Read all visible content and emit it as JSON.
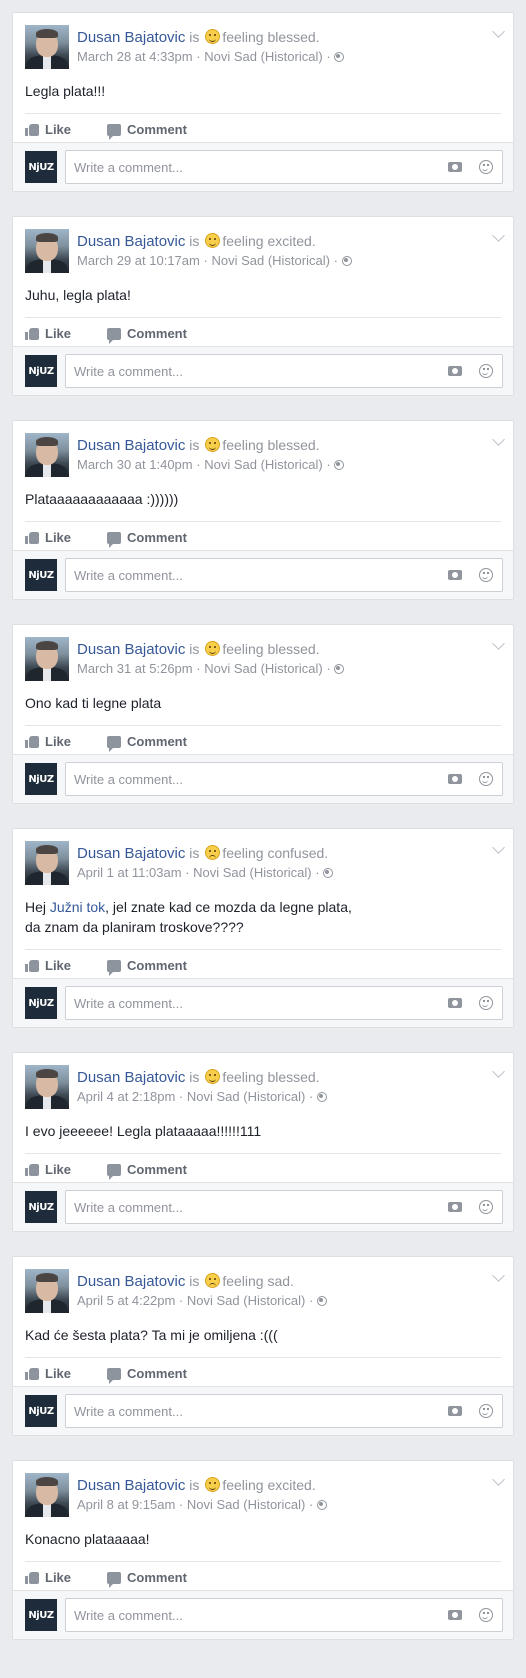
{
  "posts": [
    {
      "author": "Dusan Bajatovic",
      "is": "is",
      "feeling_icon": "blessed-emoji-icon",
      "feeling": "feeling blessed.",
      "date": "March 28 at 4:33pm",
      "location": "Novi Sad (Historical)",
      "sep": "·",
      "text_before": "Legla plata!!!",
      "mention": "",
      "text_after": "",
      "like_label": "Like",
      "comment_label": "Comment",
      "page_avatar": "NjUZ",
      "comment_placeholder": "Write a comment..."
    },
    {
      "author": "Dusan Bajatovic",
      "is": "is",
      "feeling_icon": "excited-emoji-icon",
      "feeling": "feeling excited.",
      "date": "March 29 at 10:17am",
      "location": "Novi Sad (Historical)",
      "sep": "·",
      "text_before": "Juhu, legla plata!",
      "mention": "",
      "text_after": "",
      "like_label": "Like",
      "comment_label": "Comment",
      "page_avatar": "NjUZ",
      "comment_placeholder": "Write a comment..."
    },
    {
      "author": "Dusan Bajatovic",
      "is": "is",
      "feeling_icon": "blessed-emoji-icon",
      "feeling": "feeling blessed.",
      "date": "March 30 at 1:40pm",
      "location": "Novi Sad (Historical)",
      "sep": "·",
      "text_before": "Platаaaaaaaaaaaa :))))))",
      "mention": "",
      "text_after": "",
      "like_label": "Like",
      "comment_label": "Comment",
      "page_avatar": "NjUZ",
      "comment_placeholder": "Write a comment..."
    },
    {
      "author": "Dusan Bajatovic",
      "is": "is",
      "feeling_icon": "blessed-emoji-icon",
      "feeling": "feeling blessed.",
      "date": "March 31 at 5:26pm",
      "location": "Novi Sad (Historical)",
      "sep": "·",
      "text_before": "Ono kad ti legne plata",
      "mention": "",
      "text_after": "",
      "like_label": "Like",
      "comment_label": "Comment",
      "page_avatar": "NjUZ",
      "comment_placeholder": "Write a comment..."
    },
    {
      "author": "Dusan Bajatovic",
      "is": "is",
      "feeling_icon": "confused-emoji-icon",
      "feeling": "feeling confused.",
      "date": "April 1 at 11:03am",
      "location": "Novi Sad (Historical)",
      "sep": "·",
      "text_before": "Hej ",
      "mention": "Južni tok",
      "text_after": ", jel znate kad ce mozda da legne plata, da znam da planiram troskove????",
      "like_label": "Like",
      "comment_label": "Comment",
      "page_avatar": "NjUZ",
      "comment_placeholder": "Write a comment..."
    },
    {
      "author": "Dusan Bajatovic",
      "is": "is",
      "feeling_icon": "blessed-emoji-icon",
      "feeling": "feeling blessed.",
      "date": "April 4 at 2:18pm",
      "location": "Novi Sad (Historical)",
      "sep": "·",
      "text_before": "I evo jeeeeee! Legla plataaaaa!!!!!!111",
      "mention": "",
      "text_after": "",
      "like_label": "Like",
      "comment_label": "Comment",
      "page_avatar": "NjUZ",
      "comment_placeholder": "Write a comment..."
    },
    {
      "author": "Dusan Bajatovic",
      "is": "is",
      "feeling_icon": "sad-emoji-icon",
      "feeling": "feeling sad.",
      "date": "April 5 at 4:22pm",
      "location": "Novi Sad (Historical)",
      "sep": "·",
      "text_before": "Kad će šesta plata? Ta mi je omiljena :(((",
      "mention": "",
      "text_after": "",
      "like_label": "Like",
      "comment_label": "Comment",
      "page_avatar": "NjUZ",
      "comment_placeholder": "Write a comment..."
    },
    {
      "author": "Dusan Bajatovic",
      "is": "is",
      "feeling_icon": "excited-emoji-icon",
      "feeling": "feeling excited.",
      "date": "April 8 at 9:15am",
      "location": "Novi Sad (Historical)",
      "sep": "·",
      "text_before": "Konacno plataaaaa!",
      "mention": "",
      "text_after": "",
      "like_label": "Like",
      "comment_label": "Comment",
      "page_avatar": "NjUZ",
      "comment_placeholder": "Write a comment..."
    }
  ]
}
